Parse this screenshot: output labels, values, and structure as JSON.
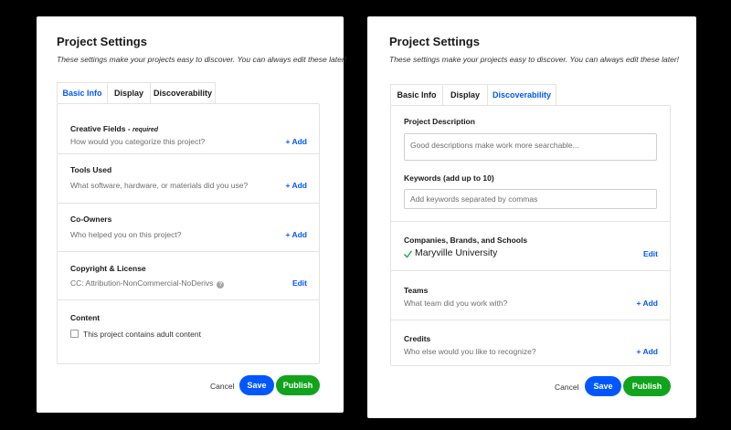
{
  "left_panel": {
    "title": "Project Settings",
    "subtitle": "These settings make your projects easy to discover. You can always edit these later!",
    "tabs": [
      {
        "label": "Basic Info",
        "active": true
      },
      {
        "label": "Display",
        "active": false
      },
      {
        "label": "Discoverability",
        "active": false
      }
    ],
    "creative_fields": {
      "title": "Creative Fields -",
      "required": "required",
      "desc": "How would you categorize this project?",
      "action": "+ Add"
    },
    "tools_used": {
      "title": "Tools Used",
      "desc": "What software, hardware, or materials did you use?",
      "action": "+ Add"
    },
    "co_owners": {
      "title": "Co-Owners",
      "desc": "Who helped you on this project?",
      "action": "+ Add"
    },
    "copyright": {
      "title": "Copyright & License",
      "desc": "CC: Attribution-NonCommercial-NoDerivs",
      "info_icon": "?",
      "action": "Edit"
    },
    "content": {
      "title": "Content",
      "checkbox_label": "This project contains adult content",
      "checked": false
    },
    "footer": {
      "cancel": "Cancel",
      "save": "Save",
      "publish": "Publish"
    }
  },
  "right_panel": {
    "title": "Project Settings",
    "subtitle": "These settings make your projects easy to discover. You can always edit these later!",
    "tabs": [
      {
        "label": "Basic Info",
        "active": false
      },
      {
        "label": "Display",
        "active": false
      },
      {
        "label": "Discoverability",
        "active": true
      }
    ],
    "description": {
      "title": "Project Description",
      "placeholder": "Good descriptions make work more searchable..."
    },
    "keywords": {
      "title": "Keywords (add up to 10)",
      "placeholder": "Add keywords separated by commas"
    },
    "companies": {
      "title": "Companies, Brands, and Schools",
      "item": "Maryville University",
      "action": "Edit"
    },
    "teams": {
      "title": "Teams",
      "desc": "What team did you work with?",
      "action": "+ Add"
    },
    "credits": {
      "title": "Credits",
      "desc": "Who else would you like to recognize?",
      "action": "+ Add"
    },
    "footer": {
      "cancel": "Cancel",
      "save": "Save",
      "publish": "Publish"
    }
  },
  "colors": {
    "accent": "#0057ff",
    "publish": "#12a31c",
    "check": "#2fa64a"
  }
}
